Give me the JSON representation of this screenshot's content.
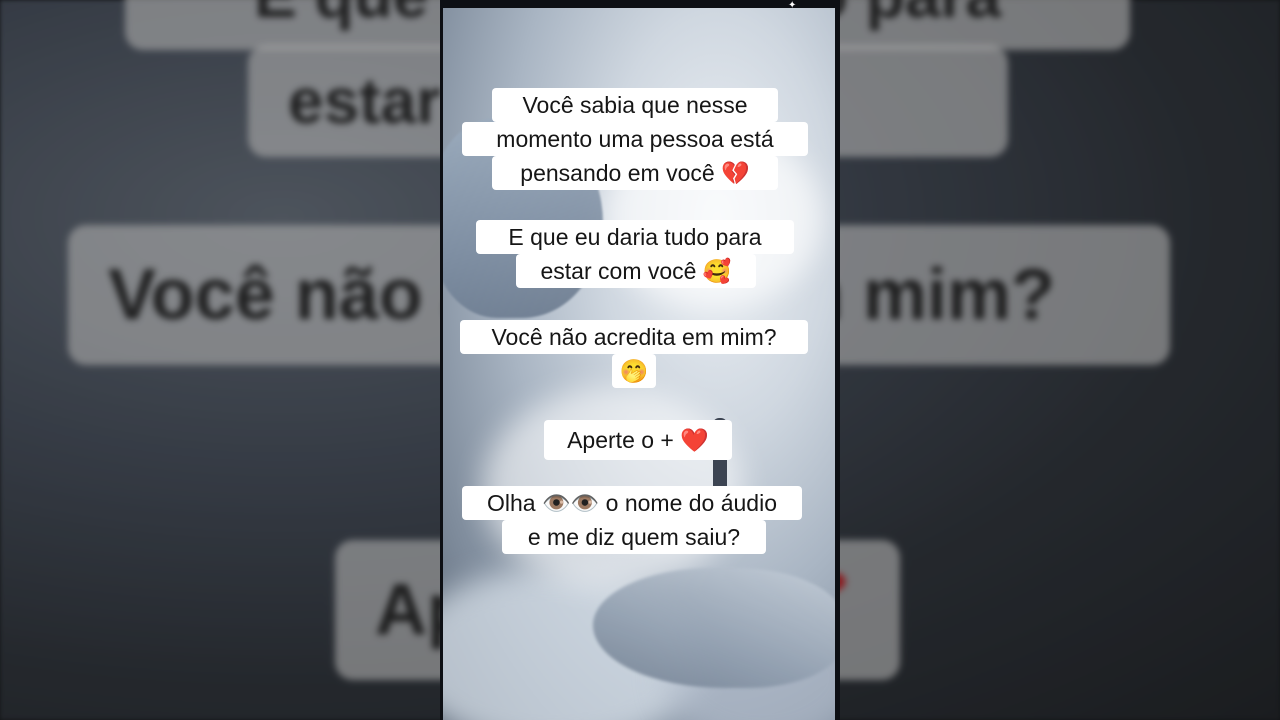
{
  "background_echo": {
    "line1": "E que eu daria tudo para",
    "line2": "estar com você",
    "line3": "Você não acredita em mim?",
    "line4": "Aperte o +",
    "heart": "❤"
  },
  "video": {
    "messages": [
      {
        "lines": [
          "Você sabia que nesse",
          "momento uma pessoa está",
          "pensando em você"
        ],
        "emoji": "💔",
        "emoji_name": "broken-heart-icon"
      },
      {
        "lines": [
          "E que eu daria tudo para",
          "estar com você"
        ],
        "emoji": "🥰",
        "emoji_name": "smiling-face-with-hearts-icon"
      },
      {
        "lines": [
          "Você não acredita em mim?"
        ],
        "emoji": "🤭",
        "emoji_name": "face-with-hand-over-mouth-icon"
      },
      {
        "lines": [
          "Aperte o +"
        ],
        "emoji": "❤️",
        "emoji_name": "red-heart-icon"
      },
      {
        "lines": [
          "Olha",
          "o nome do áudio",
          "e me diz quem saiu?"
        ],
        "emoji": "👁️👁️",
        "emoji_name": "eyes-icon"
      }
    ]
  },
  "colors": {
    "bubble_bg": "#ffffff",
    "text": "#161616",
    "heart": "#e01b2c"
  }
}
